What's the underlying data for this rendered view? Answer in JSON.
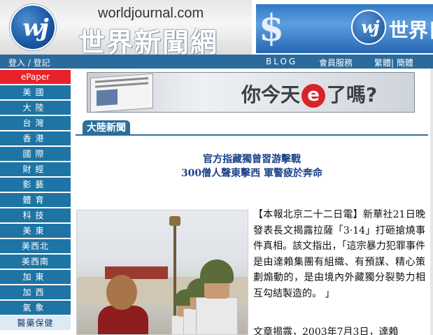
{
  "header": {
    "site_url": "worldjournal.com",
    "site_title": "世界新聞網",
    "logo_text": "wj",
    "banner_right_symbol": "$",
    "banner_right_text": "世界日"
  },
  "nav": {
    "login": "登入 / 登記",
    "blog": "BLOG",
    "member": "會員服務",
    "language": "繁體| 簡體"
  },
  "sidebar": {
    "epaper": "ePaper",
    "items": [
      "美國",
      "大陸",
      "台灣",
      "香港",
      "國際",
      "財經",
      "影藝",
      "體育",
      "科技",
      "美東",
      "美西北",
      "美西南",
      "加東",
      "加西",
      "氣象"
    ],
    "last_item": "醫藥保健"
  },
  "ad": {
    "text_before": "你今天",
    "e_letter": "e",
    "text_after": "了嗎?"
  },
  "section": {
    "title": "大陸新聞"
  },
  "article": {
    "headline_line1": "官方指藏獨曾習游擊戰",
    "headline_line2": "300僧人聲東擊西  軍警疲於奔命",
    "body_paragraph1": "【本報北京二十二日電】新華社21日晚發表長文揭露拉薩「3·14」打砸搶燒事件真相。該文指出，「這宗暴力犯罪事件是由達賴集團有組織、有預謀、精心策劃煽動的，是由境內外藏獨分裂勢力相互勾結製造的。 」",
    "body_paragraph2": "文章揭露，2003年7月3日，達賴"
  },
  "colors": {
    "nav_blue": "#2a6a9c",
    "sidebar_blue": "#1e74a4",
    "epaper_red": "#e8222a",
    "headline_blue": "#1a3f8a"
  }
}
